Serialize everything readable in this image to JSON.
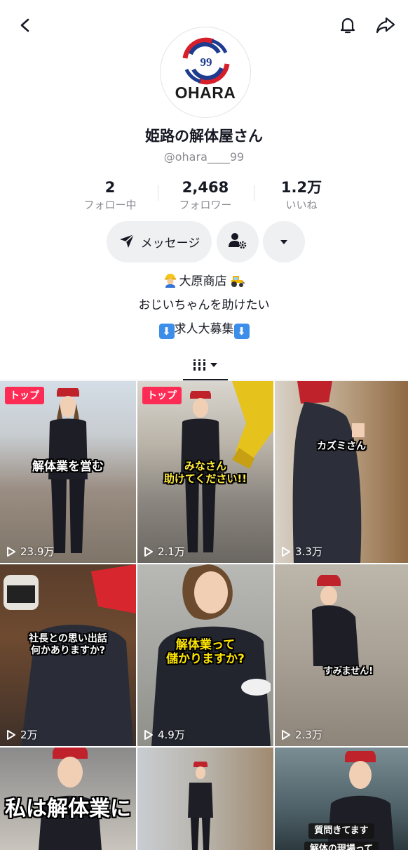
{
  "header": {
    "back_icon": "chevron-left-icon",
    "bell_icon": "bell-icon",
    "share_icon": "share-arrow-icon"
  },
  "profile": {
    "avatar_logo_text": "OHARA",
    "avatar_logo_number": "99",
    "name": "姫路の解体屋さん",
    "handle": "@ohara____99"
  },
  "stats": {
    "following": {
      "value": "2",
      "label": "フォロー中"
    },
    "followers": {
      "value": "2,468",
      "label": "フォロワー"
    },
    "likes": {
      "value": "1.2万",
      "label": "いいね"
    }
  },
  "actions": {
    "message_label": "メッセージ"
  },
  "bio": {
    "line1": "大原商店",
    "line2": "おじいちゃんを助けたい",
    "line3": "求人大募集"
  },
  "videos": [
    {
      "badge": "トップ",
      "caption": "解体業を営む",
      "views": "23.9万"
    },
    {
      "badge": "トップ",
      "caption_line1": "みなさん",
      "caption_line2": "助けてください!!",
      "views": "2.1万"
    },
    {
      "caption": "カズミさん",
      "views": "3.3万"
    },
    {
      "caption_line1": "社長との思い出話",
      "caption_line2": "何かありますか?",
      "views": "2万"
    },
    {
      "caption_line1": "解体業って",
      "caption_line2": "儲かりますか?",
      "views": "4.9万"
    },
    {
      "caption": "すみません!",
      "views": "2.3万"
    },
    {
      "caption": "私は解体業に"
    },
    {},
    {
      "caption_line1": "質問きてます",
      "caption_line2": "解体の現場って"
    }
  ],
  "colors": {
    "accent": "#fe2c55",
    "text": "#161823",
    "secondary": "#8a8b91",
    "button_bg": "#eff0f1"
  }
}
